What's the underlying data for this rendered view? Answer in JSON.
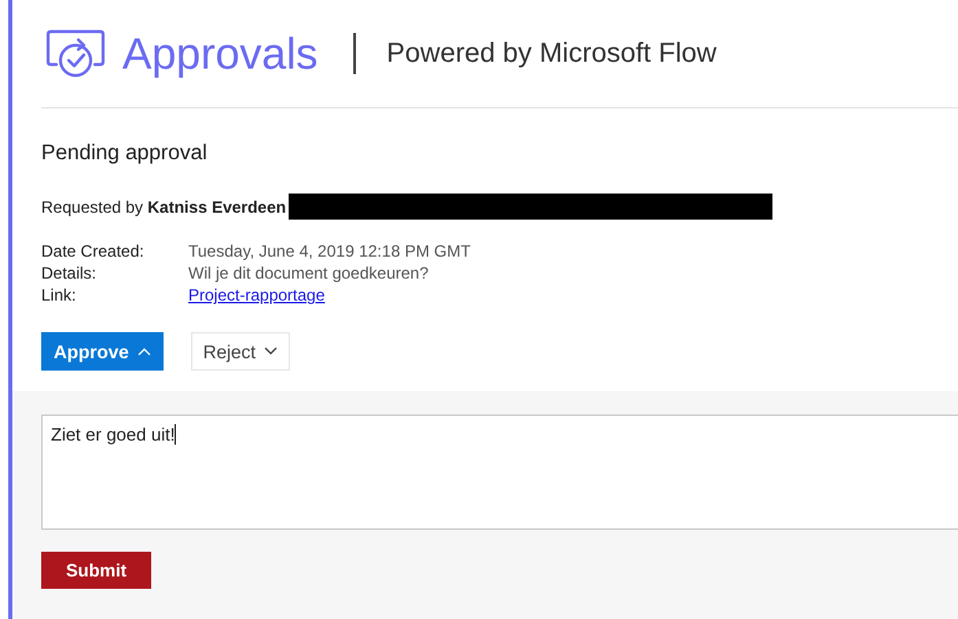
{
  "header": {
    "title": "Approvals",
    "subtitle": "Powered by Microsoft Flow"
  },
  "request": {
    "heading": "Pending approval",
    "requested_by_label": "Requested by",
    "requester": "Katniss Everdeen",
    "redacted": true,
    "fields": [
      {
        "label": "Date Created:",
        "value": "Tuesday, June 4, 2019 12:18 PM GMT",
        "kind": "text"
      },
      {
        "label": "Details:",
        "value": "Wil je dit document goedkeuren?",
        "kind": "text"
      },
      {
        "label": "Link:",
        "value": "Project-rapportage",
        "kind": "link"
      }
    ]
  },
  "actions": [
    {
      "label": "Approve",
      "selected": true,
      "expanded": true
    },
    {
      "label": "Reject",
      "selected": false,
      "expanded": false
    }
  ],
  "response": {
    "comment": "Ziet er goed uit!",
    "submit": "Submit"
  }
}
